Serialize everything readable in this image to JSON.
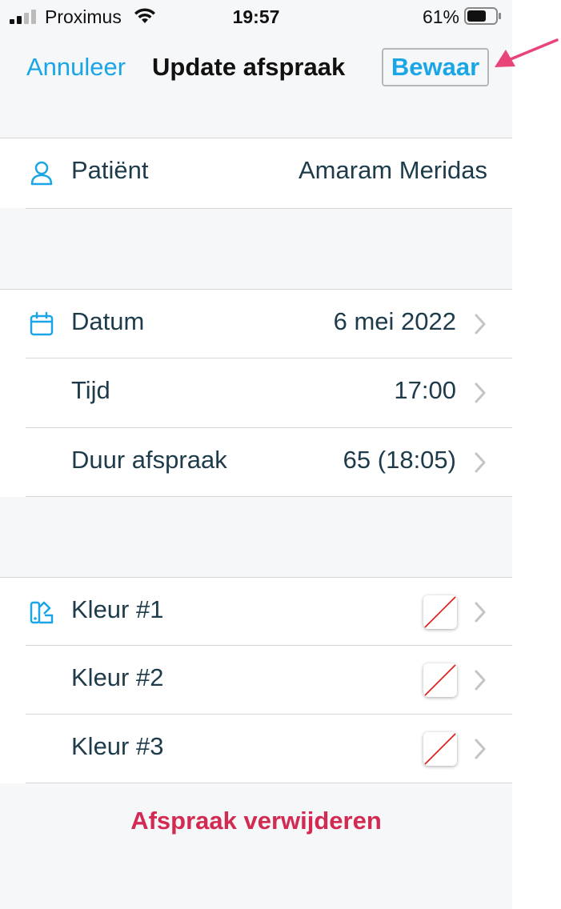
{
  "status_bar": {
    "carrier": "Proximus",
    "time": "19:57",
    "battery_percent": "61%",
    "signal_icon": "cellular-signal-icon",
    "wifi_icon": "wifi-icon",
    "battery_icon": "battery-icon"
  },
  "nav": {
    "cancel_label": "Annuleer",
    "title": "Update afspraak",
    "save_label": "Bewaar"
  },
  "patient": {
    "label": "Patiënt",
    "value": "Amaram Meridas",
    "icon": "person-icon"
  },
  "schedule": {
    "icon": "calendar-icon",
    "rows": [
      {
        "label": "Datum",
        "value": "6 mei 2022"
      },
      {
        "label": "Tijd",
        "value": "17:00"
      },
      {
        "label": "Duur afspraak",
        "value": "65 (18:05)"
      }
    ]
  },
  "colors": {
    "icon": "color-swatch-icon",
    "rows": [
      {
        "label": "Kleur #1"
      },
      {
        "label": "Kleur #2"
      },
      {
        "label": "Kleur #3"
      }
    ]
  },
  "delete_label": "Afspraak verwijderen",
  "theme": {
    "accent": "#1aa6e6",
    "text": "#1d3b4a",
    "destructive": "#d22a52",
    "annotation_arrow": "#e9447a"
  }
}
